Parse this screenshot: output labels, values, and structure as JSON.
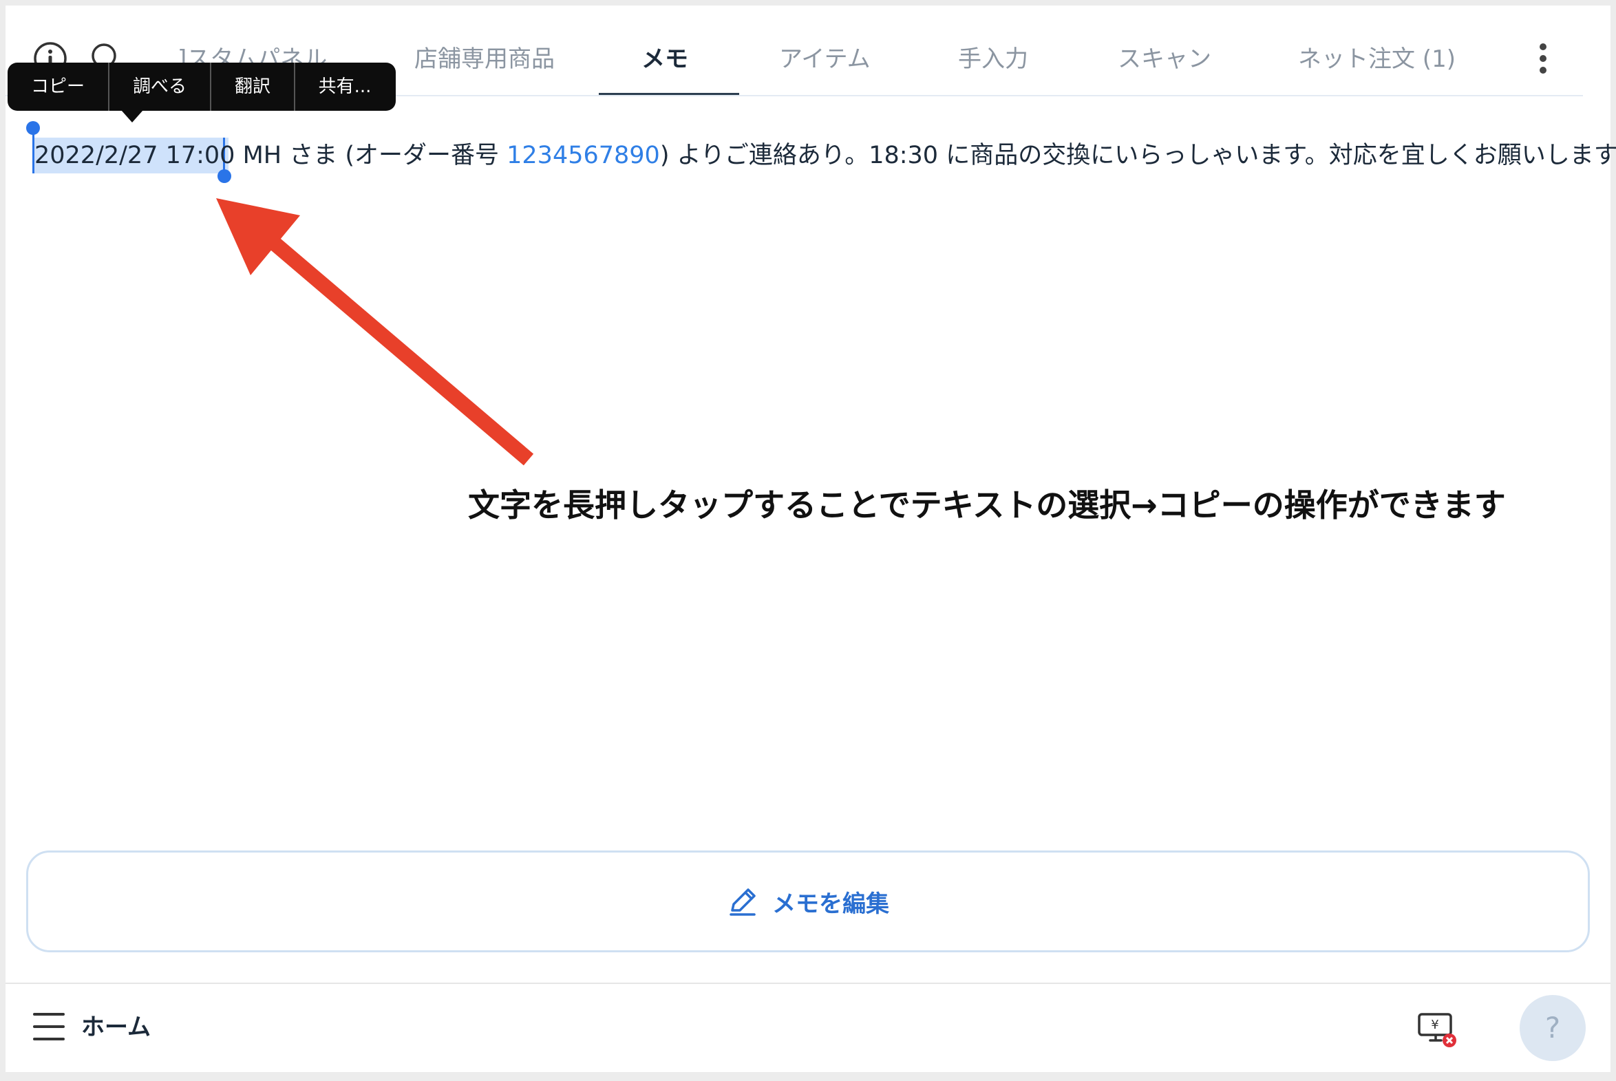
{
  "tabs": {
    "custom_panel": "]スタムパネル",
    "store_products": "店舗専用商品",
    "memo": "メモ",
    "items": "アイテム",
    "manual_input": "手入力",
    "scan": "スキャン",
    "net_order": "ネット注文 (1)"
  },
  "edit_menu": {
    "copy": "コピー",
    "look_up": "調べる",
    "translate": "翻訳",
    "share": "共有..."
  },
  "memo": {
    "selected_text": "2022/2/27 17:00",
    "text_before_number": " MH さま (オーダー番号 ",
    "order_number": "1234567890",
    "text_after_number": ") よりご連絡あり。18:30 に商品の交換にいらっしゃいます。対応を宜しくお願いします"
  },
  "annotation": {
    "caption": "文字を長押しタップすることでテキストの選択→コピーの操作ができます",
    "color": "#e8402a"
  },
  "edit_button": {
    "label": "メモを編集"
  },
  "bottom_bar": {
    "home_label": "ホーム",
    "help_label": "?"
  },
  "colors": {
    "accent": "#2a6fd1",
    "selection": "#cfe2fb",
    "link": "#2f7fe6",
    "active_tab": "#1c2a3a",
    "inactive_tab": "#8b95a1"
  },
  "icons": [
    "info-icon",
    "search-icon",
    "more-vert-icon",
    "pencil-icon",
    "menu-icon",
    "register-error-icon"
  ]
}
